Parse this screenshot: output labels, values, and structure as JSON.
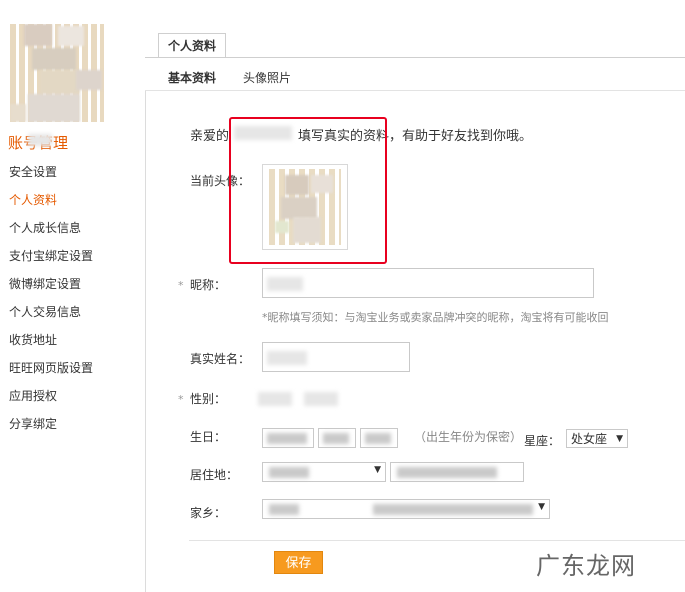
{
  "sidebar": {
    "section_title": "账号管理",
    "items": [
      {
        "label": "安全设置"
      },
      {
        "label": "个人资料",
        "active": true
      },
      {
        "label": "个人成长信息"
      },
      {
        "label": "支付宝绑定设置"
      },
      {
        "label": "微博绑定设置"
      },
      {
        "label": "个人交易信息"
      },
      {
        "label": "收货地址"
      },
      {
        "label": "旺旺网页版设置"
      },
      {
        "label": "应用授权"
      },
      {
        "label": "分享绑定"
      }
    ]
  },
  "tabs": {
    "main": "个人资料",
    "sub": [
      "基本资料",
      "头像照片"
    ]
  },
  "form": {
    "intro_prefix": "亲爱的",
    "intro_suffix": "填写真实的资料，有助于好友找到你哦。",
    "avatar_label": "当前头像：",
    "nickname_label": "昵称：",
    "nickname_hint": "*昵称填写须知：与淘宝业务或卖家品牌冲突的昵称，淘宝将有可能收回",
    "realname_label": "真实姓名：",
    "gender_label": "性别：",
    "birthday_label": "生日：",
    "birthday_note": "（出生年份为保密）",
    "zodiac_label": "星座：",
    "zodiac_value": "处女座",
    "residence_label": "居住地：",
    "hometown_label": "家乡：",
    "required_mark": "*",
    "save_label": "保存"
  },
  "watermark": "广东龙网",
  "colors": {
    "accent": "#e55a00",
    "button": "#f79a1f",
    "highlight": "#e8001f"
  },
  "icons": {
    "dropdown": "▼"
  }
}
